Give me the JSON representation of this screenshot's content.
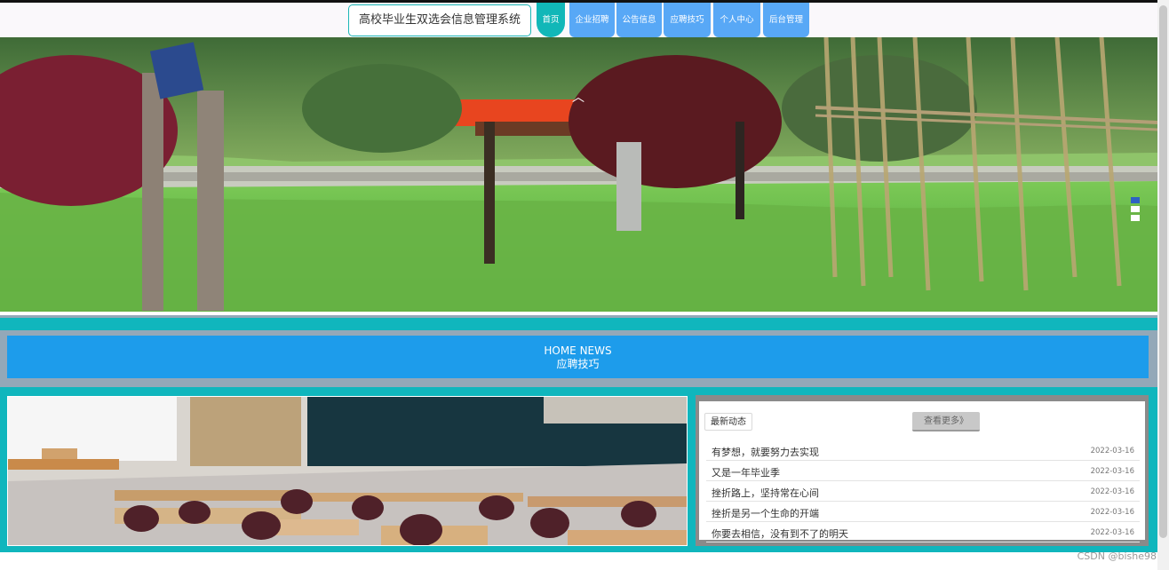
{
  "header": {
    "title": "高校毕业生双选会信息管理系统",
    "nav": [
      {
        "label": "首页",
        "active": true
      },
      {
        "label": "企业招聘",
        "active": false
      },
      {
        "label": "公告信息",
        "active": false
      },
      {
        "label": "应聘技巧",
        "active": false
      },
      {
        "label": "个人中心",
        "active": false
      },
      {
        "label": "后台管理",
        "active": false
      }
    ]
  },
  "carousel": {
    "up_icon": "chevron-up-icon",
    "down_icon": "chevron-down-icon",
    "active_index": 0,
    "dot_count": 3
  },
  "news_banner": {
    "english": "HOME NEWS",
    "chinese": "应聘技巧"
  },
  "news_panel": {
    "latest_tab": "最新动态",
    "more_button": "查看更多》",
    "items": [
      {
        "title": "有梦想，就要努力去实现",
        "date": "2022-03-16"
      },
      {
        "title": "又是一年毕业季",
        "date": "2022-03-16"
      },
      {
        "title": "挫折路上，坚持常在心间",
        "date": "2022-03-16"
      },
      {
        "title": "挫折是另一个生命的开端",
        "date": "2022-03-16"
      },
      {
        "title": "你要去相信，没有到不了的明天",
        "date": "2022-03-16"
      }
    ]
  },
  "watermark": "CSDN @bishe98",
  "colors": {
    "teal": "#10b6bd",
    "blue": "#58a8f6",
    "news_blue": "#1d9ceb"
  }
}
